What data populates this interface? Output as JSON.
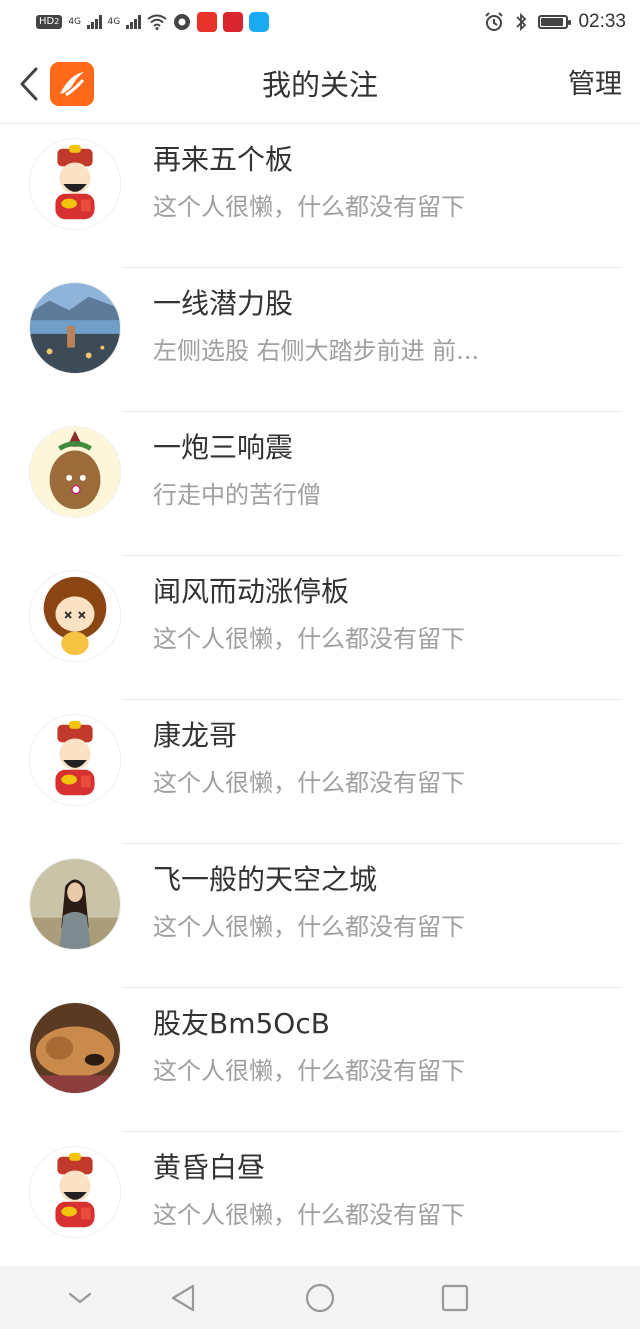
{
  "status_bar": {
    "hd_badge": "HD",
    "hd_sub": "2",
    "net1": "4G",
    "net2": "4G",
    "time": "02:33",
    "battery_level": 0.9
  },
  "header": {
    "title": "我的关注",
    "manage_label": "管理"
  },
  "follows": [
    {
      "name": "再来五个板",
      "desc": "这个人很懒，什么都没有留下",
      "avatar": "fortune-god-avatar"
    },
    {
      "name": "一线潜力股",
      "desc": "左侧选股 右侧大踏步前进 前...",
      "avatar": "landscape-avatar"
    },
    {
      "name": "一炮三响震",
      "desc": "行走中的苦行僧",
      "avatar": "potato-avatar"
    },
    {
      "name": "闻风而动涨停板",
      "desc": "这个人很懒，什么都没有留下",
      "avatar": "cartoon-girl-avatar"
    },
    {
      "name": "康龙哥",
      "desc": "这个人很懒，什么都没有留下",
      "avatar": "fortune-god-avatar"
    },
    {
      "name": "飞一般的天空之城",
      "desc": "这个人很懒，什么都没有留下",
      "avatar": "woman-photo-avatar"
    },
    {
      "name": "股友Bm5OcB",
      "desc": "这个人很懒，什么都没有留下",
      "avatar": "dog-photo-avatar"
    },
    {
      "name": "黄昏白昼",
      "desc": "这个人很懒，什么都没有留下",
      "avatar": "fortune-god-avatar"
    }
  ],
  "colors": {
    "brand": "#ff6a1a",
    "title_text": "#333333",
    "desc_text": "#a0a0a0"
  }
}
